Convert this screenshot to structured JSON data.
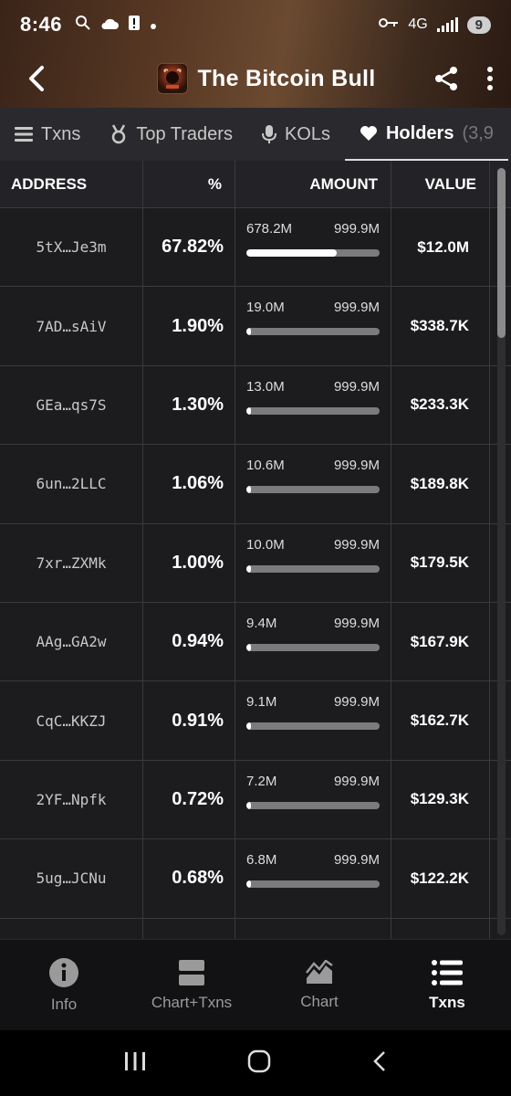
{
  "status_bar": {
    "time": "8:46",
    "network": "4G",
    "battery": "9"
  },
  "app_bar": {
    "title": "The Bitcoin Bull"
  },
  "tabs": [
    {
      "label": "Txns",
      "icon": "list-icon"
    },
    {
      "label": "Top Traders",
      "icon": "medal-icon"
    },
    {
      "label": "KOLs",
      "icon": "microphone-icon"
    },
    {
      "label": "Holders",
      "count": "(3,9",
      "icon": "heart-icon",
      "active": true
    }
  ],
  "table": {
    "headers": {
      "address": "ADDRESS",
      "percent": "%",
      "amount": "AMOUNT",
      "value": "VALUE"
    },
    "rows": [
      {
        "address": "5tX…Je3m",
        "percent": "67.82%",
        "amount": "678.2M",
        "total": "999.9M",
        "fill": 0.6782,
        "value": "$12.0M"
      },
      {
        "address": "7AD…sAiV",
        "percent": "1.90%",
        "amount": "19.0M",
        "total": "999.9M",
        "fill": 0.019,
        "value": "$338.7K"
      },
      {
        "address": "GEa…qs7S",
        "percent": "1.30%",
        "amount": "13.0M",
        "total": "999.9M",
        "fill": 0.013,
        "value": "$233.3K"
      },
      {
        "address": "6un…2LLC",
        "percent": "1.06%",
        "amount": "10.6M",
        "total": "999.9M",
        "fill": 0.0106,
        "value": "$189.8K"
      },
      {
        "address": "7xr…ZXMk",
        "percent": "1.00%",
        "amount": "10.0M",
        "total": "999.9M",
        "fill": 0.01,
        "value": "$179.5K"
      },
      {
        "address": "AAg…GA2w",
        "percent": "0.94%",
        "amount": "9.4M",
        "total": "999.9M",
        "fill": 0.0094,
        "value": "$167.9K"
      },
      {
        "address": "CqC…KKZJ",
        "percent": "0.91%",
        "amount": "9.1M",
        "total": "999.9M",
        "fill": 0.0091,
        "value": "$162.7K"
      },
      {
        "address": "2YF…Npfk",
        "percent": "0.72%",
        "amount": "7.2M",
        "total": "999.9M",
        "fill": 0.0072,
        "value": "$129.3K"
      },
      {
        "address": "5ug…JCNu",
        "percent": "0.68%",
        "amount": "6.8M",
        "total": "999.9M",
        "fill": 0.0068,
        "value": "$122.2K"
      }
    ]
  },
  "bottom_nav": [
    {
      "label": "Info",
      "icon": "info-icon"
    },
    {
      "label": "Chart+Txns",
      "icon": "split-view-icon"
    },
    {
      "label": "Chart",
      "icon": "chart-icon"
    },
    {
      "label": "Txns",
      "icon": "list-icon",
      "active": true
    }
  ]
}
